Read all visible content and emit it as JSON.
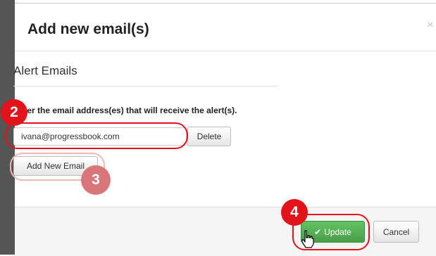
{
  "dialog": {
    "title": "Add new email(s)",
    "close_glyph": "×"
  },
  "section": {
    "title": "Alert Emails",
    "instruction": "Enter the email address(es) that will receive the alert(s)."
  },
  "emails": [
    {
      "value": "ivana@progressbook.com",
      "delete_label": "Delete"
    }
  ],
  "add_button_label": "Add New Email",
  "footer": {
    "update_label": "Update",
    "update_icon": "check-icon",
    "cancel_label": "Cancel"
  },
  "callouts": [
    {
      "number": "2",
      "color": "#e3131b"
    },
    {
      "number": "3",
      "color": "#d8767c"
    },
    {
      "number": "4",
      "color": "#e3131b"
    }
  ]
}
